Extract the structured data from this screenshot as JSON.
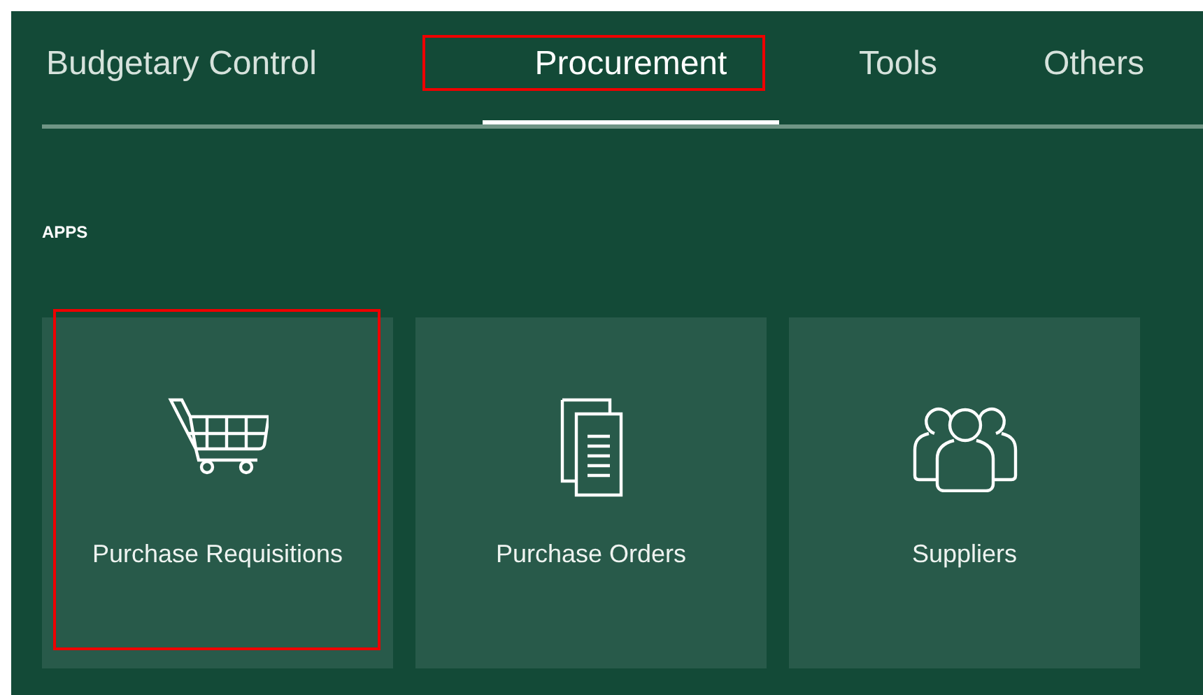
{
  "tabs": [
    {
      "label": "Budgetary Control",
      "selected": false,
      "highlighted": false
    },
    {
      "label": "Procurement",
      "selected": true,
      "highlighted": true
    },
    {
      "label": "Tools",
      "selected": false,
      "highlighted": false
    },
    {
      "label": "Others",
      "selected": false,
      "highlighted": false
    }
  ],
  "section_title": "APPS",
  "tiles": [
    {
      "label": "Purchase Requisitions",
      "kind": "cart",
      "highlighted": true
    },
    {
      "label": "Purchase Orders",
      "kind": "documents",
      "highlighted": false
    },
    {
      "label": "Suppliers",
      "kind": "people",
      "highlighted": false
    }
  ]
}
